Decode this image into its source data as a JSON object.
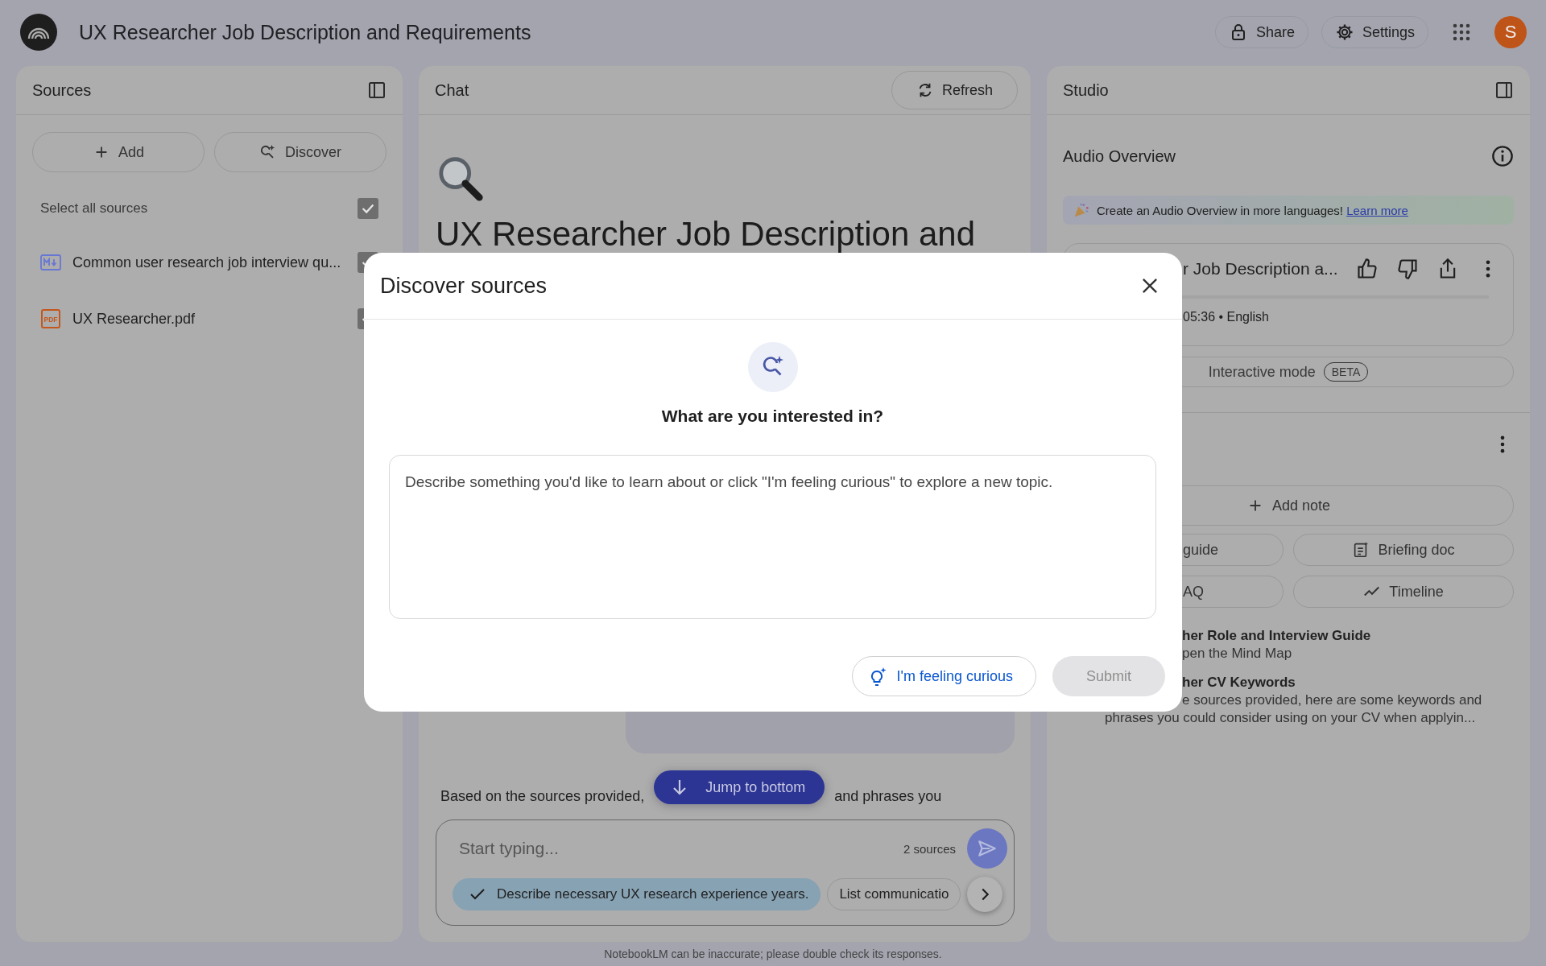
{
  "app_bar": {
    "title": "UX Researcher Job Description and Requirements",
    "buttons": [
      {
        "label": "Share"
      },
      {
        "label": "Settings"
      }
    ],
    "avatar": "S"
  },
  "sources": {
    "title": "Sources",
    "buttons": [
      {
        "label": "Add"
      },
      {
        "label": "Discover"
      }
    ],
    "select_all": {
      "label": "Select all sources",
      "checked": true
    },
    "items": [
      {
        "kind": "markdown",
        "name": "Common user research job interview qu...",
        "checked": true
      },
      {
        "kind": "pdf",
        "icon_label": "PDF",
        "name": "UX Researcher.pdf",
        "checked": true
      }
    ]
  },
  "chat": {
    "title": "Chat",
    "refresh": "Refresh",
    "heading": "UX Researcher Job Description and",
    "answer_before": "Based on the sources provided,",
    "answer_after": "and phrases you",
    "jump": "Jump to bottom",
    "input": {
      "placeholder": "Start typing...",
      "count": "2 sources"
    },
    "suggestions": [
      {
        "label": "Describe necessary UX research experience years.",
        "selected": true
      },
      {
        "label": "List communicatio",
        "selected": false
      }
    ]
  },
  "studio": {
    "title": "Studio",
    "audio": {
      "title": "Audio Overview",
      "banner": {
        "text": "Create an Audio Overview in more languages!",
        "link": "Learn more"
      },
      "card": {
        "title": "r Job Description a...",
        "meta": "05:36 • English"
      },
      "interactive": {
        "label": "Interactive mode",
        "badge": "BETA"
      }
    },
    "notes": {
      "add": "Add note",
      "buttons": [
        {
          "label": "guide"
        },
        {
          "label": "Briefing doc"
        },
        {
          "label": "AQ"
        },
        {
          "label": "Timeline"
        }
      ],
      "items": [
        {
          "title": "her Role and Interview Guide",
          "lines": [
            {
              "text": "pen the Mind Map",
              "clipped": true
            }
          ]
        },
        {
          "title": "her CV Keywords",
          "lines": [
            {
              "text": "e sources provided, here are some keywords and",
              "clipped": true
            },
            {
              "text": "phrases you could consider using on your CV when applyin...",
              "clipped": false
            }
          ]
        }
      ]
    }
  },
  "modal": {
    "title": "Discover sources",
    "heading": "What are you interested in?",
    "placeholder": "Describe something you'd like to learn about or click \"I'm feeling curious\" to explore a new topic.",
    "curious": "I'm feeling curious",
    "submit": {
      "label": "Submit",
      "disabled": true
    }
  },
  "footer": "NotebookLM can be inaccurate; please double check its responses."
}
